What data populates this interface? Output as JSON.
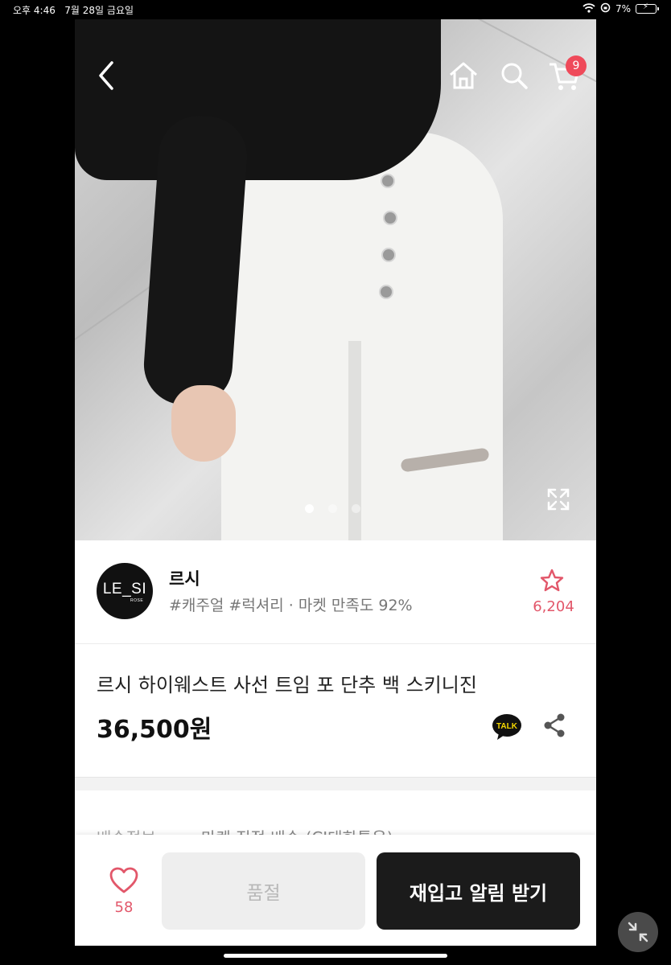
{
  "status_bar": {
    "time": "오후 4:46",
    "date": "7월 28일 금요일",
    "battery": "7%"
  },
  "nav": {
    "cart_count": "9"
  },
  "carousel": {
    "total": 3,
    "active": 1
  },
  "shop": {
    "logo_text": "LE_SI",
    "logo_sub": "ROSE",
    "name": "르시",
    "tags": "#캐주얼 #럭셔리 · 마켓 만족도 92%",
    "favorite_count": "6,204"
  },
  "product": {
    "name": "르시 하이웨스트 사선 트임 포 단추 백 스키니진",
    "price": "36,500원"
  },
  "delivery": {
    "label": "배송정보",
    "value": "마켓 직접 배송 (CJ대한통운)"
  },
  "bottom_bar": {
    "like_count": "58",
    "soldout_label": "품절",
    "restock_label": "재입고 알림 받기"
  },
  "colors": {
    "accent": "#e2576a",
    "badge": "#ef4a5a",
    "primary_button": "#1b1b1b",
    "disabled_button": "#eeeeee"
  }
}
